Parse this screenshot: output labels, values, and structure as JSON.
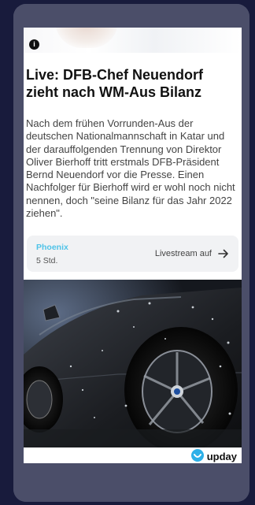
{
  "article": {
    "headline": "Live: DFB-Chef Neuendorf zieht nach WM-Aus Bilanz",
    "body": "Nach dem frühen Vorrunden-Aus der deutschen Nationalmannschaft in Katar und der darauffolgenden Trennung von Direktor Oliver Bierhoff tritt erstmals DFB-Präsident Bernd Neuendorf vor die Presse. Einen Nachfolger für Bierhoff wird er wohl noch nicht nennen, doch \"seine Bilanz für das Jahr 2022 ziehen\"."
  },
  "source": {
    "name": "Phoenix",
    "time": "5 Std.",
    "link_label": "Livestream auf"
  },
  "branding": {
    "logo_text": "upday",
    "logo_color": "#2db0e8"
  },
  "icons": {
    "info": "info-icon",
    "arrow": "arrow-right-icon",
    "logo": "upday-logo-icon"
  },
  "colors": {
    "background": "#181b3c",
    "panel": "#4b4e69",
    "source_accent": "#4fc3e8"
  }
}
